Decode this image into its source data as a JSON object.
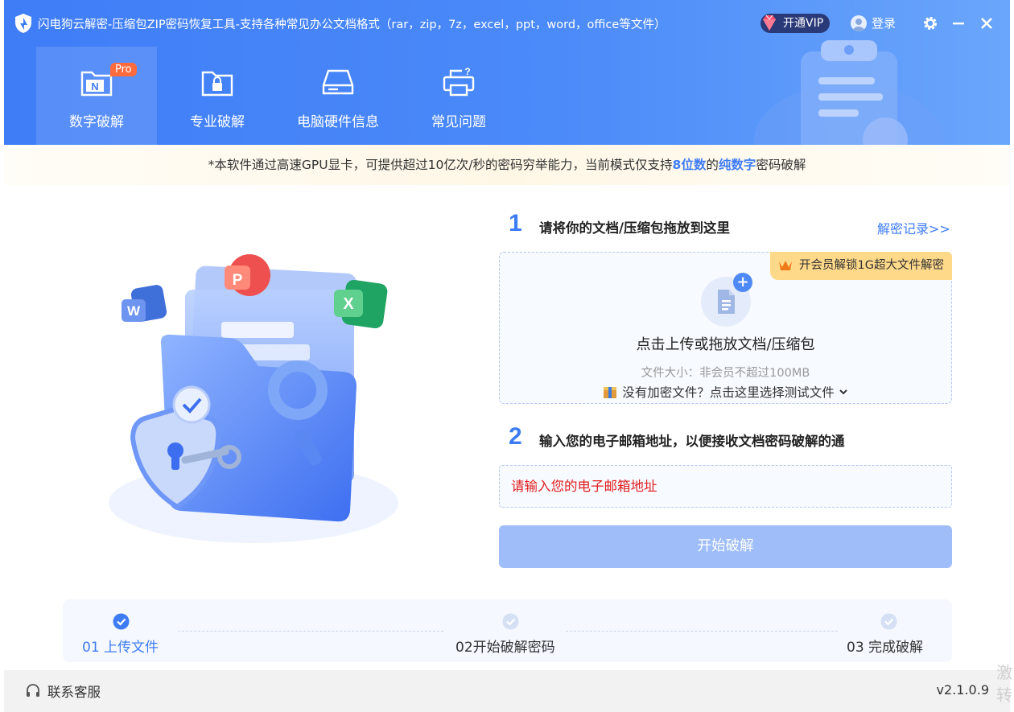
{
  "window": {
    "title": "闪电狗云解密-压缩包ZIP密码恢复工具-支持各种常见办公文档格式（rar，zip，7z，excel，ppt，word，office等文件）",
    "vip_label": "开通VIP",
    "login_label": "登录"
  },
  "nav": {
    "items": [
      {
        "label": "数字破解",
        "active": true,
        "badge": "Pro"
      },
      {
        "label": "专业破解"
      },
      {
        "label": "电脑硬件信息"
      },
      {
        "label": "常见问题"
      }
    ]
  },
  "notice": {
    "prefix": "*本软件通过高速GPU显卡，可提供超过10亿次/秒的密码穷举能力，当前模式仅支持",
    "highlight1": "8位数",
    "middle": "的",
    "highlight2": "纯数字",
    "suffix": "密码破解"
  },
  "step1": {
    "number": "1",
    "title": "请将你的文档/压缩包拖放到这里",
    "records_link": "解密记录>>",
    "member_tag": "开会员解锁1G超大文件解密",
    "upload_text": "点击上传或拖放文档/压缩包",
    "size_text": "文件大小：非会员不超过100MB",
    "test_file_text": "没有加密文件？点击这里选择测试文件"
  },
  "step2": {
    "number": "2",
    "title": "输入您的电子邮箱地址，以便接收文档密码破解的通",
    "email_placeholder": "请输入您的电子邮箱地址",
    "start_button": "开始破解"
  },
  "progress": {
    "steps": [
      {
        "label": "01 上传文件",
        "done": true
      },
      {
        "label": "02开始破解密码",
        "done": false
      },
      {
        "label": "03 完成破解",
        "done": false
      }
    ]
  },
  "footer": {
    "support_label": "联系客服",
    "version": "v2.1.0.9"
  },
  "illustration": {
    "badges": [
      "P",
      "W",
      "X"
    ]
  },
  "watermark": "激转",
  "colors": {
    "accent": "#3e7cf5",
    "header": "#4b8af9",
    "error": "#e02020",
    "button_disabled": "#9fbdf8"
  }
}
